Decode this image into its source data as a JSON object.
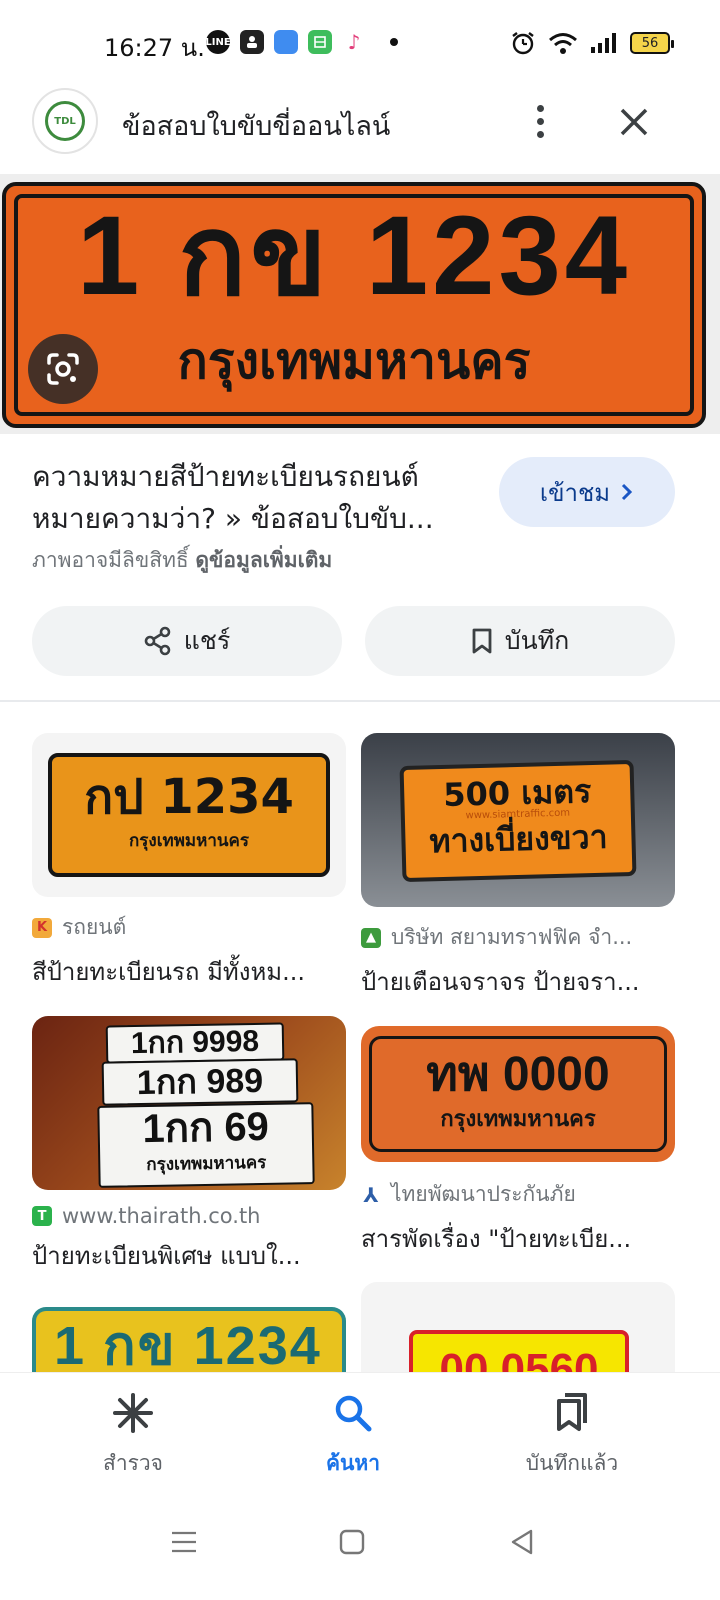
{
  "status_bar": {
    "time": "16:27 น.",
    "battery": "56"
  },
  "header": {
    "title": "ข้อสอบใบขับขี่ออนไลน์"
  },
  "hero": {
    "plate_line1": "1 กข 1234",
    "plate_line2": "กรุงเทพมหานคร",
    "plate_color": "#e8621d"
  },
  "result": {
    "title_line1": "ความหมายสีป้ายทะเบียนรถยนต์",
    "title_line2": "หมายความว่า? » ข้อสอบใบขับ...",
    "visit_label": "เข้าชม",
    "copyright_text": "ภาพอาจมีลิขสิทธิ์",
    "learn_more": "ดูข้อมูลเพิ่มเติม",
    "share_label": "แชร์",
    "save_label": "บันทึก"
  },
  "grid": [
    {
      "plate_line1": "กป 1234",
      "plate_line2": "กรุงเทพมหานคร",
      "source": "รถยนต์",
      "caption": "สีป้ายทะเบียนรถ มีทั้งหม..."
    },
    {
      "sign_line1": "500 เมตร",
      "sign_line2": "ทางเบี่ยงขวา",
      "watermark": "www.siamtraffic.com",
      "source": "บริษัท สยามทราฟฟิค จำ...",
      "caption": "ป้ายเตือนจราจร ป้ายจรา..."
    },
    {
      "plate_row1": "1กก 9998",
      "plate_row2": "1กก 989",
      "plate_row3": "1กก 69",
      "plate_city": "กรุงเทพมหานคร",
      "source": "www.thairath.co.th",
      "caption": "ป้ายทะเบียนพิเศษ แบบใ..."
    },
    {
      "plate_line1": "ทพ 0000",
      "plate_line2": "กรุงเทพมหานคร",
      "source": "ไทยพัฒนาประกันภัย",
      "caption": "สารพัดเรื่อง \"ป้ายทะเบีย..."
    },
    {
      "plate_line1": "1 กข 1234"
    },
    {
      "plate_partial": "00 0560"
    }
  ],
  "bottom_nav": {
    "items": [
      {
        "label": "สำรวจ",
        "icon": "asterisk-icon"
      },
      {
        "label": "ค้นหา",
        "icon": "search-icon"
      },
      {
        "label": "บันทึกแล้ว",
        "icon": "bookmarks-icon"
      }
    ],
    "active_color": "#1a73e8"
  }
}
